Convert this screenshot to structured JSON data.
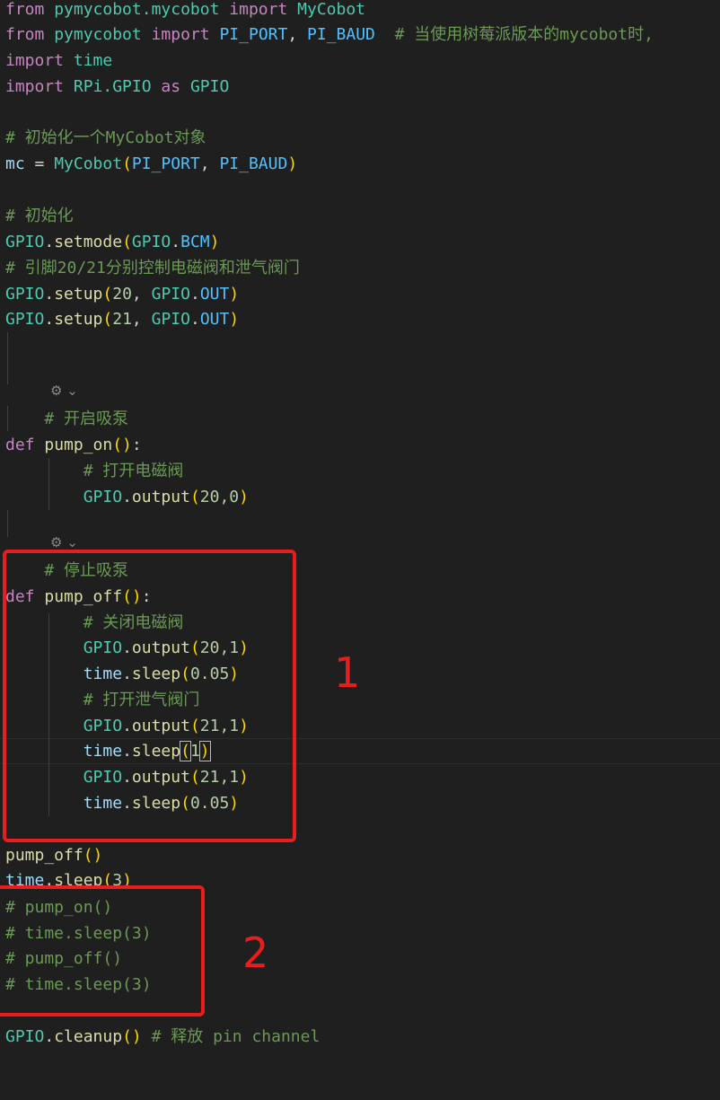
{
  "lines": {
    "l1": {
      "kw_from": "from",
      "mod": "pymycobot.mycobot",
      "kw_import": "import",
      "cls": "MyCobot"
    },
    "l2": {
      "kw_from": "from",
      "mod": "pymycobot",
      "kw_import": "import",
      "c1": "PI_PORT",
      "comma": ",",
      "c2": "PI_BAUD",
      "comment": "# 当使用树莓派版本的mycobot时,"
    },
    "l3": {
      "kw_import": "import",
      "mod": "time"
    },
    "l4": {
      "kw_import": "import",
      "mod": "RPi.GPIO",
      "kw_as": "as",
      "alias": "GPIO"
    },
    "l6": {
      "comment": "# 初始化一个MyCobot对象"
    },
    "l7": {
      "var": "mc",
      "eq": " = ",
      "cls": "MyCobot",
      "open": "(",
      "a1": "PI_PORT",
      "comma": ", ",
      "a2": "PI_BAUD",
      "close": ")"
    },
    "l9": {
      "comment": "# 初始化"
    },
    "l10": {
      "obj": "GPIO",
      "dot": ".",
      "fn": "setmode",
      "open": "(",
      "a1": "GPIO",
      "dot2": ".",
      "a2": "BCM",
      "close": ")"
    },
    "l11": {
      "comment": "# 引脚20/21分别控制电磁阀和泄气阀门"
    },
    "l12": {
      "obj": "GPIO",
      "dot": ".",
      "fn": "setup",
      "open": "(",
      "n": "20",
      "comma": ", ",
      "a1": "GPIO",
      "dot2": ".",
      "a2": "OUT",
      "close": ")"
    },
    "l13": {
      "obj": "GPIO",
      "dot": ".",
      "fn": "setup",
      "open": "(",
      "n": "21",
      "comma": ", ",
      "a1": "GPIO",
      "dot2": ".",
      "a2": "OUT",
      "close": ")"
    },
    "l17": {
      "comment": "# 开启吸泵"
    },
    "l18": {
      "kw_def": "def",
      "fn": "pump_on",
      "paren": "()",
      "colon": ":"
    },
    "l19": {
      "comment": "# 打开电磁阀"
    },
    "l20": {
      "obj": "GPIO",
      "dot": ".",
      "fn": "output",
      "open": "(",
      "args": "20,0",
      "close": ")"
    },
    "l23": {
      "comment": "# 停止吸泵"
    },
    "l24": {
      "kw_def": "def",
      "fn": "pump_off",
      "paren": "()",
      "colon": ":"
    },
    "l25": {
      "comment": "# 关闭电磁阀"
    },
    "l26": {
      "obj": "GPIO",
      "dot": ".",
      "fn": "output",
      "open": "(",
      "args": "20,1",
      "close": ")"
    },
    "l27": {
      "obj": "time",
      "dot": ".",
      "fn": "sleep",
      "open": "(",
      "args": "0.05",
      "close": ")"
    },
    "l28": {
      "comment": "# 打开泄气阀门"
    },
    "l29": {
      "obj": "GPIO",
      "dot": ".",
      "fn": "output",
      "open": "(",
      "args": "21,1",
      "close": ")"
    },
    "l30": {
      "obj": "time",
      "dot": ".",
      "fn": "sleep",
      "open": "(",
      "args": "1",
      "close": ")"
    },
    "l31": {
      "obj": "GPIO",
      "dot": ".",
      "fn": "output",
      "open": "(",
      "args": "21,1",
      "close": ")"
    },
    "l32": {
      "obj": "time",
      "dot": ".",
      "fn": "sleep",
      "open": "(",
      "args": "0.05",
      "close": ")"
    },
    "l34": {
      "fn": "pump_off",
      "paren": "()"
    },
    "l35": {
      "obj": "time",
      "dot": ".",
      "fn": "sleep",
      "open": "(",
      "args": "3",
      "close": ")"
    },
    "l36": {
      "comment": "# pump_on()"
    },
    "l37": {
      "comment": "# time.sleep(3)"
    },
    "l38": {
      "comment": "# pump_off()"
    },
    "l39": {
      "comment": "# time.sleep(3)"
    },
    "l41": {
      "obj": "GPIO",
      "dot": ".",
      "fn": "cleanup",
      "paren": "()",
      "comment": " # 释放 pin channel"
    }
  },
  "annotations": {
    "box1_label": "1",
    "box2_label": "2"
  },
  "colors": {
    "keyword": "#c586c0",
    "function": "#dcdcaa",
    "variable": "#9cdcfe",
    "class": "#4ec9b0",
    "constant": "#4fc1ff",
    "number": "#b5cea8",
    "comment": "#6a9955",
    "bracket": "#ffd700",
    "annotation": "#e81e1e",
    "background": "#1f1f1f"
  },
  "icons": {
    "codelens": "codelens-icon",
    "chevron": "chevron-down-icon"
  }
}
